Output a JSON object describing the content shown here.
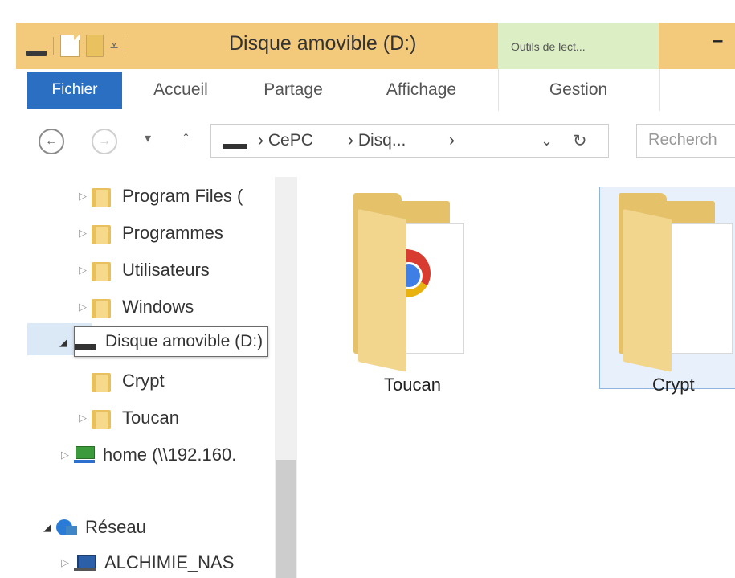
{
  "titlebar": {
    "title": "Disque amovible (D:)",
    "context_tab": "Outils de lect...",
    "minimize": "–"
  },
  "ribbon": {
    "tabs": [
      "Fichier",
      "Accueil",
      "Partage",
      "Affichage",
      "Gestion"
    ]
  },
  "address": {
    "crumbs": [
      "CePC",
      "Disq...",
      ""
    ],
    "separator": "›",
    "search_placeholder": "Recherch"
  },
  "nav_tree": [
    {
      "label": "Program Files (",
      "type": "folder"
    },
    {
      "label": "Programmes",
      "type": "folder"
    },
    {
      "label": "Utilisateurs",
      "type": "folder"
    },
    {
      "label": "Windows",
      "type": "folder"
    },
    {
      "label": "Disque amovible (D:)",
      "type": "drive",
      "selected": true
    },
    {
      "label": "Crypt",
      "type": "folder"
    },
    {
      "label": "Toucan",
      "type": "folder"
    },
    {
      "label": "home (\\\\192.160.",
      "type": "network-drive"
    },
    {
      "label": "Réseau",
      "type": "network"
    },
    {
      "label": "ALCHIMIE_NAS",
      "type": "computer"
    }
  ],
  "files": [
    {
      "name": "Toucan",
      "icon": "folder-chrome-icon"
    },
    {
      "name": "Crypt",
      "icon": "folder-icon",
      "selected": true
    }
  ],
  "colors": {
    "title_band": "#f3c97c",
    "context_tab": "#dbeec4",
    "file_tab": "#2a6fc1"
  }
}
